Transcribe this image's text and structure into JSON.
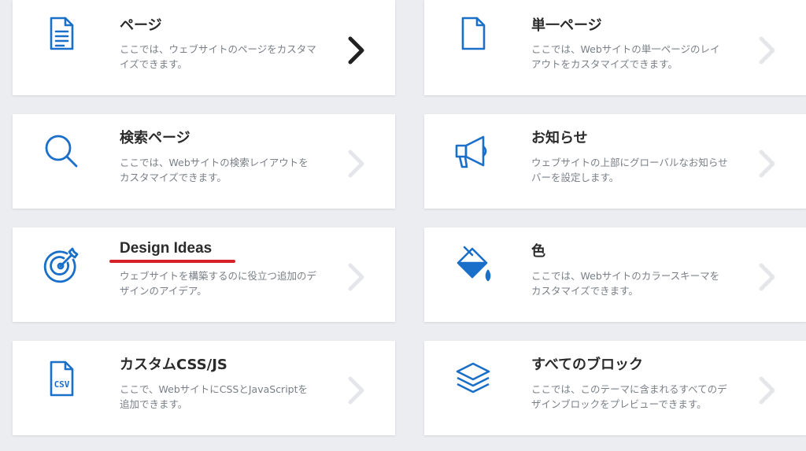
{
  "colors": {
    "accent": "#1a6fc9",
    "annotation": "#d8202a",
    "chevron_active": "#222222",
    "chevron_inactive": "#e4e6e9"
  },
  "cards": [
    {
      "title": "ページ",
      "description": "ここでは、ウェブサイトのページをカスタマイズできます。",
      "icon": "document-icon",
      "active": true
    },
    {
      "title": "単一ページ",
      "description": "ここでは、Webサイトの単一ページのレイアウトをカスタマイズできます。",
      "icon": "blank-page-icon",
      "active": false
    },
    {
      "title": "検索ページ",
      "description": "ここでは、Webサイトの検索レイアウトをカスタマイズできます。",
      "icon": "search-icon",
      "active": false
    },
    {
      "title": "お知らせ",
      "description": "ウェブサイトの上部にグローバルなお知らせバーを設定します。",
      "icon": "megaphone-icon",
      "active": false
    },
    {
      "title": "Design Ideas",
      "description": "ウェブサイトを構築するのに役立つ追加のデザインのアイデア。",
      "icon": "target-icon",
      "active": false,
      "underlined": true
    },
    {
      "title": "色",
      "description": "ここでは、Webサイトのカラースキーマをカスタマイズできます。",
      "icon": "paint-bucket-icon",
      "active": false
    },
    {
      "title": "カスタムCSS/JS",
      "description": "ここで、WebサイトにCSSとJavaScriptを追加できます。",
      "icon": "csv-file-icon",
      "icon_text": "CSV",
      "active": false
    },
    {
      "title": "すべてのブロック",
      "description": "ここでは、このテーマに含まれるすべてのデザインブロックをプレビューできます。",
      "icon": "layers-icon",
      "active": false
    }
  ]
}
